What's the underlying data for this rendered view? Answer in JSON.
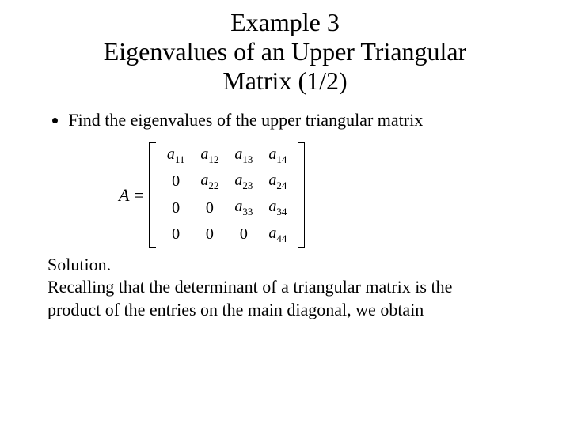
{
  "title": {
    "line1": "Example 3",
    "line2": "Eigenvalues of an Upper Triangular",
    "line3": "Matrix (1/2)"
  },
  "bullet": "Find the eigenvalues of the upper triangular matrix",
  "matrix": {
    "lhs": "A",
    "eq": "=",
    "rows": [
      [
        "a11",
        "a12",
        "a13",
        "a14"
      ],
      [
        "0",
        "a22",
        "a23",
        "a24"
      ],
      [
        "0",
        "0",
        "a33",
        "a34"
      ],
      [
        "0",
        "0",
        "0",
        "a44"
      ]
    ],
    "entry_base": "a"
  },
  "solution": {
    "heading": "Solution.",
    "line1": "Recalling that the determinant of a triangular matrix is the",
    "line2": "product of the entries on the main diagonal, we obtain"
  }
}
